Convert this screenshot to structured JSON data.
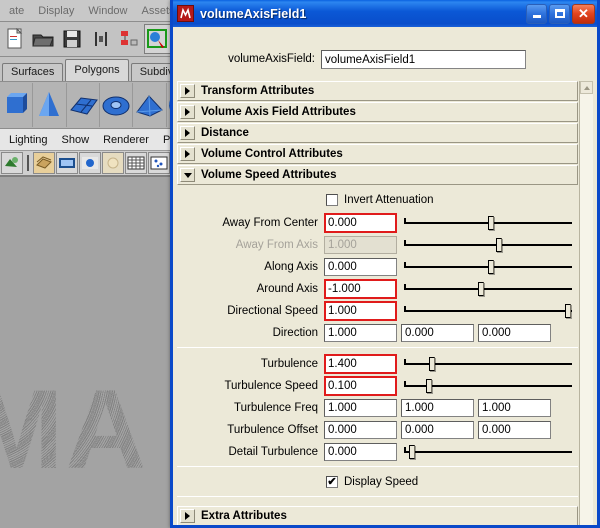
{
  "background_app": {
    "menubar": [
      "ate",
      "Display",
      "Window",
      "Assets"
    ],
    "tabs": [
      {
        "label": "Surfaces",
        "active": false
      },
      {
        "label": "Polygons",
        "active": true
      },
      {
        "label": "Subdivs",
        "active": false
      }
    ],
    "menubar2": [
      "Lighting",
      "Show",
      "Renderer",
      "Panels"
    ],
    "viewport_text": "MA"
  },
  "window": {
    "title": "volumeAxisField1",
    "icon": "maya-app-icon",
    "minimize_label": "Minimize",
    "maximize_label": "Maximize",
    "close_label": "Close"
  },
  "name_field": {
    "label": "volumeAxisField:",
    "value": "volumeAxisField1"
  },
  "sections": [
    {
      "title": "Transform Attributes",
      "expanded": false
    },
    {
      "title": "Volume Axis Field Attributes",
      "expanded": false
    },
    {
      "title": "Distance",
      "expanded": false
    },
    {
      "title": "Volume Control Attributes",
      "expanded": false
    },
    {
      "title": "Volume Speed Attributes",
      "expanded": true
    },
    {
      "title": "Extra Attributes",
      "expanded": false
    }
  ],
  "volume_speed": {
    "invert_attenuation": {
      "label": "Invert Attenuation",
      "checked": false
    },
    "rows": [
      {
        "label": "Away From Center",
        "value": "0.000",
        "keyed": true,
        "disabled": false,
        "slider": 50
      },
      {
        "label": "Away From Axis",
        "value": "1.000",
        "keyed": false,
        "disabled": true,
        "slider": 55
      },
      {
        "label": "Along Axis",
        "value": "0.000",
        "keyed": false,
        "disabled": false,
        "slider": 50
      },
      {
        "label": "Around Axis",
        "value": "-1.000",
        "keyed": true,
        "disabled": false,
        "slider": 44
      },
      {
        "label": "Directional Speed",
        "value": "1.000",
        "keyed": true,
        "disabled": false,
        "slider": 96
      }
    ],
    "direction": {
      "label": "Direction",
      "values": [
        "1.000",
        "0.000",
        "0.000"
      ]
    },
    "turbulence_rows": [
      {
        "label": "Turbulence",
        "value": "1.400",
        "keyed": true,
        "slider": 15
      },
      {
        "label": "Turbulence Speed",
        "value": "0.100",
        "keyed": true,
        "slider": 13
      }
    ],
    "turbulence_freq": {
      "label": "Turbulence Freq",
      "values": [
        "1.000",
        "1.000",
        "1.000"
      ]
    },
    "turbulence_offset": {
      "label": "Turbulence Offset",
      "values": [
        "0.000",
        "0.000",
        "0.000"
      ]
    },
    "detail_turbulence": {
      "label": "Detail Turbulence",
      "value": "0.000",
      "slider": 3
    },
    "display_speed": {
      "label": "Display Speed",
      "checked": true
    }
  },
  "colors": {
    "titlebar_blue": "#0b58d6",
    "dialog_face": "#ece9d8",
    "keyed_border": "#e01b1b",
    "viewport_gray": "#a3a3a3"
  }
}
